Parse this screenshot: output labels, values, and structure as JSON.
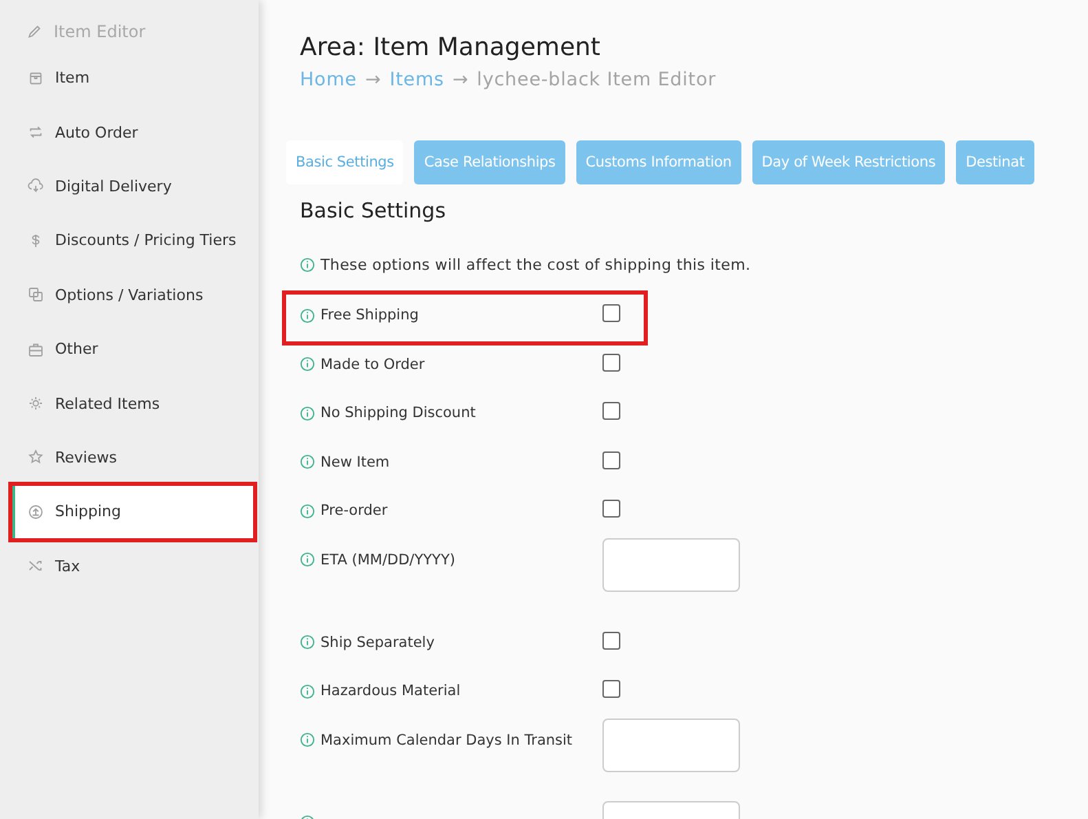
{
  "sidebar": {
    "title": "Item Editor",
    "items": [
      {
        "label": "Item",
        "selected": false,
        "highlighted": false
      },
      {
        "label": "Auto Order",
        "selected": false,
        "highlighted": false
      },
      {
        "label": "Digital Delivery",
        "selected": false,
        "highlighted": false
      },
      {
        "label": "Discounts / Pricing Tiers",
        "selected": false,
        "highlighted": false
      },
      {
        "label": "Options / Variations",
        "selected": false,
        "highlighted": false
      },
      {
        "label": "Other",
        "selected": false,
        "highlighted": false
      },
      {
        "label": "Related Items",
        "selected": false,
        "highlighted": false
      },
      {
        "label": "Reviews",
        "selected": false,
        "highlighted": false
      },
      {
        "label": "Shipping",
        "selected": true,
        "highlighted": true
      },
      {
        "label": "Tax",
        "selected": false,
        "highlighted": false
      }
    ]
  },
  "header": {
    "title": "Area: Item Management",
    "breadcrumb": [
      {
        "label": "Home",
        "link": true
      },
      {
        "label": "→",
        "link": false
      },
      {
        "label": "Items",
        "link": true
      },
      {
        "label": "→",
        "link": false
      },
      {
        "label": "lychee-black Item Editor",
        "link": false
      }
    ]
  },
  "tabs": [
    {
      "label": "Basic Settings",
      "selected": true
    },
    {
      "label": "Case Relationships",
      "selected": false
    },
    {
      "label": "Customs Information",
      "selected": false
    },
    {
      "label": "Day of Week Restrictions",
      "selected": false
    },
    {
      "label": "Destinat",
      "selected": false
    }
  ],
  "section": {
    "title": "Basic Settings",
    "note": "These options will affect the cost of shipping this item.",
    "rows": [
      {
        "kind": "checkbox",
        "label": "Free Shipping",
        "checked": false,
        "highlighted": true
      },
      {
        "kind": "checkbox",
        "label": "Made to Order",
        "checked": false,
        "highlighted": false
      },
      {
        "kind": "checkbox",
        "label": "No Shipping Discount",
        "checked": false,
        "highlighted": false
      },
      {
        "kind": "checkbox",
        "label": "New Item",
        "checked": false,
        "highlighted": false
      },
      {
        "kind": "checkbox",
        "label": "Pre-order",
        "checked": false,
        "highlighted": false
      },
      {
        "kind": "field",
        "label": "ETA (MM/DD/YYYY)",
        "highlighted": false
      },
      {
        "kind": "checkbox",
        "label": "Ship Separately",
        "checked": false,
        "highlighted": false
      },
      {
        "kind": "checkbox",
        "label": "Hazardous Material",
        "checked": false,
        "highlighted": false
      },
      {
        "kind": "field",
        "label": "Maximum Calendar Days In Transit",
        "highlighted": false
      },
      {
        "kind": "field",
        "highlighted": false
      }
    ]
  }
}
